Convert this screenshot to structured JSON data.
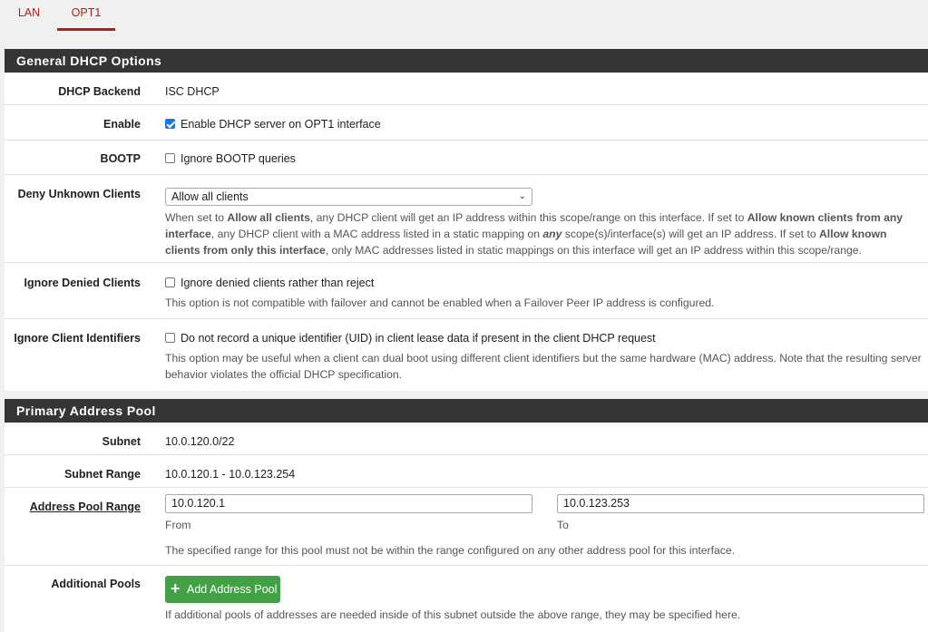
{
  "tabs": [
    {
      "label": "LAN",
      "active": false
    },
    {
      "label": "OPT1",
      "active": true
    }
  ],
  "general": {
    "title": "General DHCP Options",
    "backend": {
      "label": "DHCP Backend",
      "value": "ISC DHCP"
    },
    "enable": {
      "label": "Enable",
      "checked": true,
      "text": "Enable DHCP server on OPT1 interface"
    },
    "bootp": {
      "label": "BOOTP",
      "checked": false,
      "text": "Ignore BOOTP queries"
    },
    "deny_unknown": {
      "label": "Deny Unknown Clients",
      "selected": "Allow all clients",
      "help": {
        "p1": "When set to ",
        "b1": "Allow all clients",
        "p2": ", any DHCP client will get an IP address within this scope/range on this interface. If set to ",
        "b2": "Allow known clients from any interface",
        "p3": ", any DHCP client with a MAC address listed in a static mapping on ",
        "b3": "any",
        "p4": " scope(s)/interface(s) will get an IP address. If set to ",
        "b4": "Allow known clients from only this interface",
        "p5": ", only MAC addresses listed in static mappings on this interface will get an IP address within this scope/range."
      }
    },
    "ignore_denied": {
      "label": "Ignore Denied Clients",
      "checked": false,
      "text": "Ignore denied clients rather than reject",
      "help": "This option is not compatible with failover and cannot be enabled when a Failover Peer IP address is configured."
    },
    "ignore_client_ids": {
      "label": "Ignore Client Identifiers",
      "checked": false,
      "text": "Do not record a unique identifier (UID) in client lease data if present in the client DHCP request",
      "help": "This option may be useful when a client can dual boot using different client identifiers but the same hardware (MAC) address. Note that the resulting server behavior violates the official DHCP specification."
    }
  },
  "pool": {
    "title": "Primary Address Pool",
    "subnet": {
      "label": "Subnet",
      "value": "10.0.120.0/22"
    },
    "subnet_range": {
      "label": "Subnet Range",
      "value": "10.0.120.1 - 10.0.123.254"
    },
    "range": {
      "label": "Address Pool Range",
      "from_value": "10.0.120.1",
      "from_label": "From",
      "to_value": "10.0.123.253",
      "to_label": "To",
      "help": "The specified range for this pool must not be within the range configured on any other address pool for this interface."
    },
    "additional": {
      "label": "Additional Pools",
      "button": "Add Address Pool",
      "help": "If additional pools of addresses are needed inside of this subnet outside the above range, they may be specified here."
    }
  },
  "colors": {
    "accent": "#b71c1c",
    "header_bg": "#353535",
    "button_green": "#43a047",
    "checkbox_blue": "#1a73e8"
  }
}
